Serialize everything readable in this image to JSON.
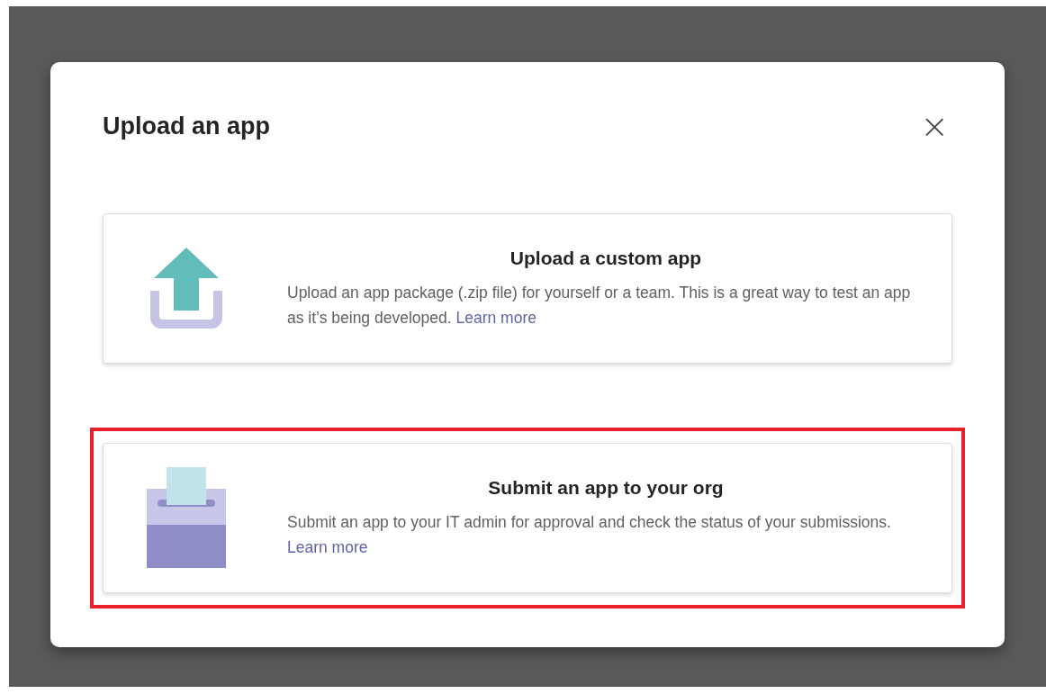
{
  "dialog": {
    "title": "Upload an app",
    "close_label": "×"
  },
  "options": [
    {
      "kind": "upload",
      "title": "Upload a custom app",
      "description": "Upload an app package (.zip file) for yourself or a team. This is a great way to test an app as it’s being developed.",
      "link": "Learn more",
      "highlighted": false
    },
    {
      "kind": "submit",
      "title": "Submit an app to your org",
      "description": "Submit an app to your IT admin for approval and check the status of your submissions.",
      "link": "Learn more",
      "highlighted": true
    }
  ]
}
